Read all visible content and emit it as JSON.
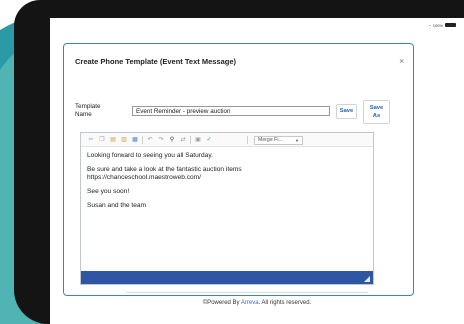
{
  "status_bar": {
    "battery_text": "100%"
  },
  "dialog": {
    "title": "Create Phone Template (Event Text Message)",
    "close_glyph": "×",
    "template_name_label_line1": "Template",
    "template_name_label_line2": "Name",
    "template_name_value": "Event Reminder - preview auction",
    "save_label": "Save",
    "save_as_line1": "Save",
    "save_as_line2": "As"
  },
  "editor": {
    "toolbar": {
      "icons": [
        "cut-icon",
        "copy-icon",
        "paste-icon",
        "paste-text-icon",
        "paste-word-icon",
        "undo-icon",
        "redo-icon",
        "find-icon",
        "replace-icon",
        "select-all-icon",
        "spellcheck-icon"
      ],
      "merge_fields_label": "Merge Fi...",
      "merge_caret": "▼"
    },
    "body": {
      "line1": "Looking forward to seeing you all Saturday.",
      "line2a": "Be sure and take a look at the fantastic auction items",
      "line2b": "https://chanceschool.maestroweb.com/",
      "line3": "See you soon!",
      "line4": "Susan and the team"
    }
  },
  "footer": {
    "prefix": "©Powered By ",
    "brand": "Arreva",
    "suffix": ". All rights reserved."
  },
  "colors": {
    "dialog_border": "#3c8f86",
    "editor_footer": "#2f56a4",
    "button_text": "#2a63b0",
    "swoosh_teal": "#2a9aa6",
    "tablet_bezel": "#141414"
  }
}
